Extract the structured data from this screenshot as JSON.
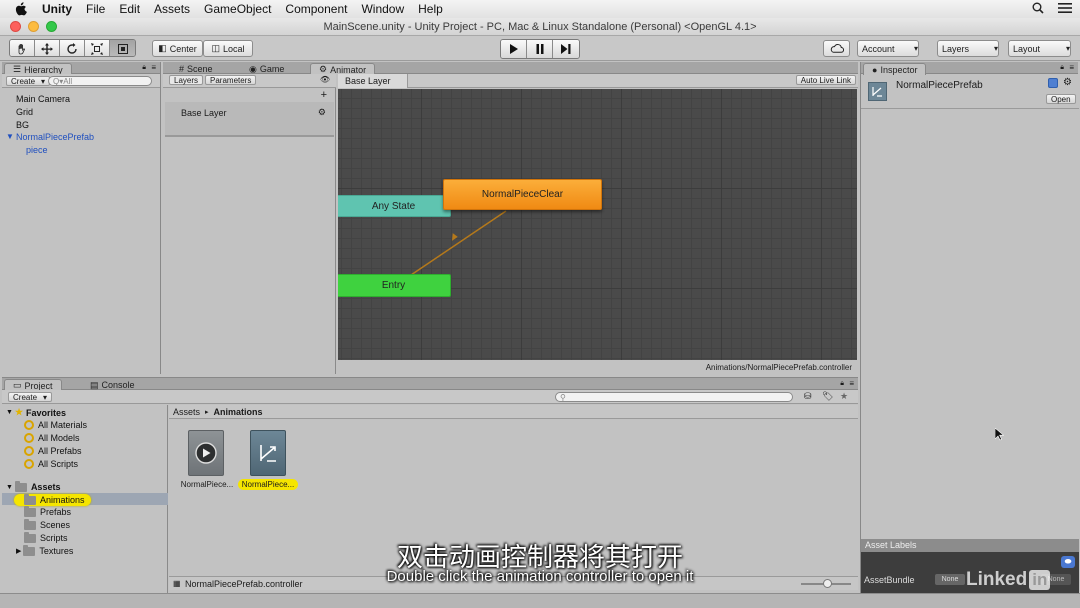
{
  "menubar": {
    "app": "Unity",
    "items": [
      "File",
      "Edit",
      "Assets",
      "GameObject",
      "Component",
      "Window",
      "Help"
    ]
  },
  "window": {
    "title": "MainScene.unity - Unity Project - PC, Mac & Linux Standalone (Personal) <OpenGL 4.1>"
  },
  "toolbar": {
    "pivot": "Center",
    "space": "Local",
    "account": "Account",
    "layers": "Layers",
    "layout": "Layout"
  },
  "hierarchy": {
    "tab": "Hierarchy",
    "create": "Create",
    "search_placeholder": "Q▾All",
    "items": [
      "Main Camera",
      "Grid",
      "BG",
      "NormalPiecePrefab",
      "piece"
    ]
  },
  "center_tabs": {
    "scene": "Scene",
    "game": "Game",
    "animator": "Animator"
  },
  "animator": {
    "layers_tab": "Layers",
    "parameters_tab": "Parameters",
    "layer_name": "Base Layer",
    "breadcrumb": "Base Layer",
    "auto_live_link": "Auto Live Link",
    "nodes": {
      "any_state": "Any State",
      "entry": "Entry",
      "clip": "NormalPieceClear"
    },
    "footer_path": "Animations/NormalPiecePrefab.controller"
  },
  "inspector": {
    "tab": "Inspector",
    "object_name": "NormalPiecePrefab",
    "open_button": "Open",
    "asset_labels": "Asset Labels",
    "asset_bundle": "AssetBundle",
    "asset_bundle_value": "None",
    "asset_bundle_variant": "None"
  },
  "project": {
    "tab": "Project",
    "console_tab": "Console",
    "create": "Create",
    "favorites_label": "Favorites",
    "favorites": [
      "All Materials",
      "All Models",
      "All Prefabs",
      "All Scripts"
    ],
    "assets_label": "Assets",
    "folders": [
      "Animations",
      "Prefabs",
      "Scenes",
      "Scripts",
      "Textures"
    ],
    "breadcrumb": [
      "Assets",
      "Animations"
    ],
    "files": [
      "NormalPiece...",
      "NormalPiece..."
    ],
    "footer_file": "NormalPiecePrefab.controller"
  },
  "subtitles": {
    "cn": "双击动画控制器将其打开",
    "en": "Double click the animation controller to open it"
  },
  "watermark": {
    "text": "Linked",
    "suffix": "in"
  },
  "colors": {
    "any_state": "#5fc4b0",
    "entry": "#3fd23f",
    "clip": "#f79a1f",
    "selection": "#f5e500",
    "link_blue": "#1f4fbf"
  }
}
